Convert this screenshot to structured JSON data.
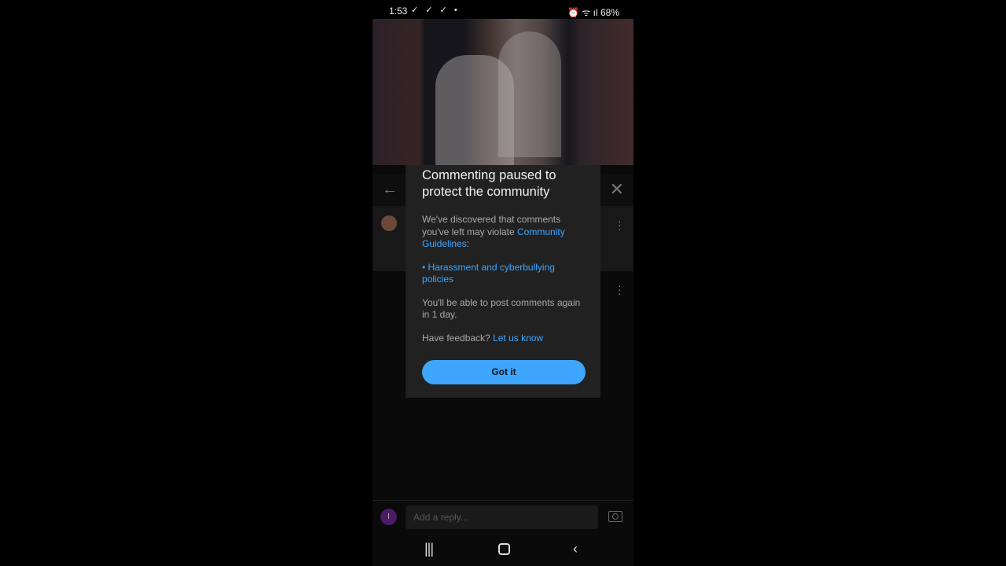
{
  "status_bar": {
    "time": "1:53",
    "notification_icons": [
      "check-icon",
      "check-icon",
      "check-icon",
      "dot-icon"
    ],
    "right_icons": [
      "battery-saver-icon",
      "alarm-icon",
      "wifi-icon",
      "volte-signal-icon"
    ],
    "battery": "68%"
  },
  "dialog": {
    "title": "Commenting paused to protect the community",
    "body_prefix": "We've discovered that comments you've left may violate ",
    "guidelines_link": "Community Guidelines",
    "body_suffix": ":",
    "policy": "• Harassment and cyberbullying policies",
    "resume": "You'll be able to post comments again in 1 day.",
    "feedback_prefix": "Have feedback? ",
    "feedback_link": "Let us know",
    "button": "Got it"
  },
  "reply": {
    "avatar_letter": "I",
    "placeholder": "Add a reply..."
  },
  "colors": {
    "accent": "#3ea6ff",
    "dialog_bg": "#212121"
  }
}
